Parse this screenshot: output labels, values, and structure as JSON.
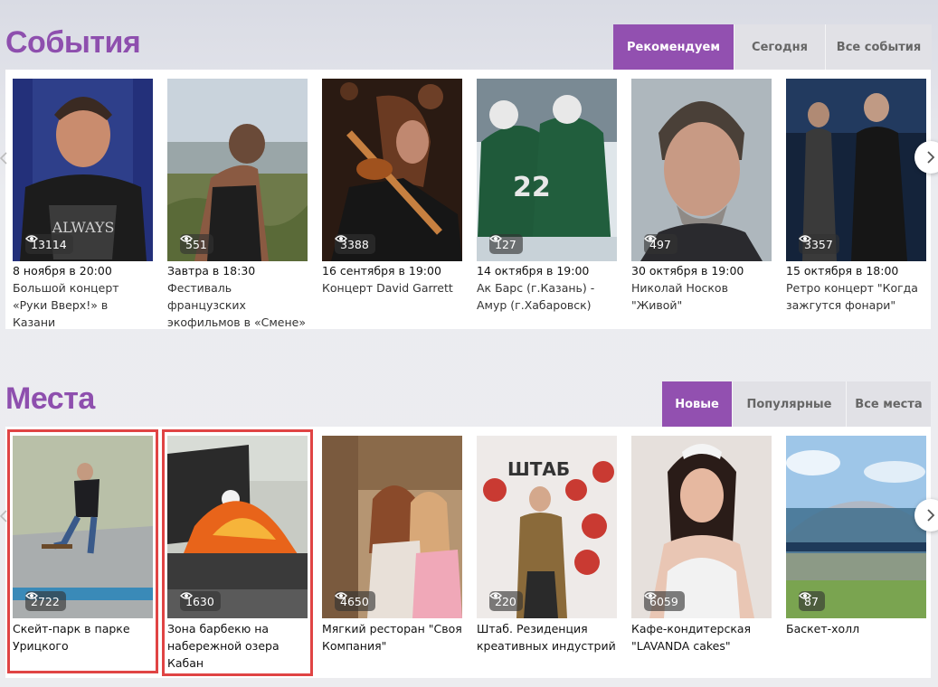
{
  "events": {
    "title": "События",
    "tabs": [
      {
        "label": "Рекомендуем",
        "active": true
      },
      {
        "label": "Сегодня",
        "active": false
      },
      {
        "label": "Все события",
        "active": false
      }
    ],
    "cards": [
      {
        "views": "13114",
        "date": "8 ноября в 20:00",
        "title": "Большой концерт «Руки Вверх!» в Казани"
      },
      {
        "views": "551",
        "date": "Завтра в 18:30",
        "title": "Фестиваль французских экофильмов в «Смене»"
      },
      {
        "views": "3388",
        "date": "16 сентября в 19:00",
        "title": "Концерт David Garrett"
      },
      {
        "views": "127",
        "date": "14 октября в 19:00",
        "title": "Ак Барс (г.Казань) - Амур (г.Хабаровск)"
      },
      {
        "views": "497",
        "date": "30 октября в 19:00",
        "title": "Николай Носков \"Живой\""
      },
      {
        "views": "3357",
        "date": "15 октября в 18:00",
        "title": "Ретро концерт \"Когда зажгутся фонари\""
      }
    ]
  },
  "places": {
    "title": "Места",
    "tabs": [
      {
        "label": "Новые",
        "active": true
      },
      {
        "label": "Популярные",
        "active": false
      },
      {
        "label": "Все места",
        "active": false
      }
    ],
    "cards": [
      {
        "views": "2722",
        "title": "Скейт-парк в парке Урицкого",
        "highlighted": true
      },
      {
        "views": "1630",
        "title": "Зона барбекю на набережной озера Кабан",
        "highlighted": true
      },
      {
        "views": "4650",
        "title": "Мягкий ресторан \"Своя Компания\"",
        "highlighted": false
      },
      {
        "views": "220",
        "title": "Штаб. Резиденция креативных индустрий",
        "highlighted": false
      },
      {
        "views": "6059",
        "title": "Кафе-кондитерская \"LAVANDA cakes\"",
        "highlighted": false
      },
      {
        "views": "87",
        "title": "Баскет-холл",
        "highlighted": false
      }
    ]
  },
  "colors": {
    "accent": "#9250b0",
    "highlight": "#e04444"
  }
}
